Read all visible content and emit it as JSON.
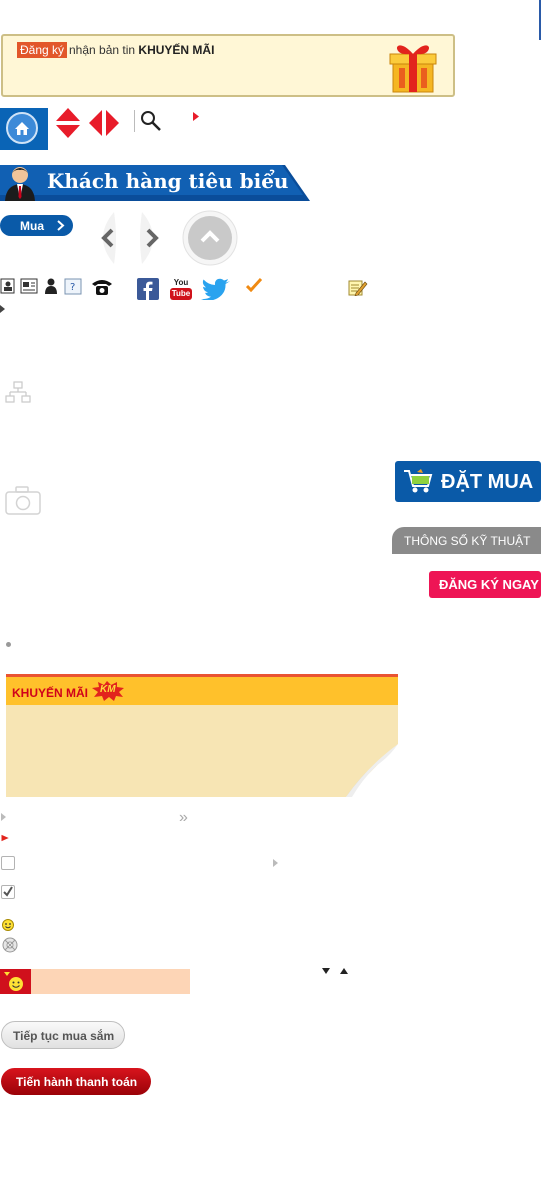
{
  "newsletter": {
    "register_label": "Đăng ký",
    "text_prefix": "nhận bản tin",
    "text_bold": "KHUYẾN MÃI",
    "gift_icon": "gift-box-icon"
  },
  "nav": {
    "home_icon": "home-icon",
    "search_icon": "search-icon"
  },
  "customers": {
    "title": "Khách hàng tiêu biểu"
  },
  "buy": {
    "label": "Mua"
  },
  "social": {
    "icons": [
      "contacts-icon",
      "news-icon",
      "person-icon",
      "help-icon",
      "phone-icon",
      "facebook-icon",
      "youtube-icon",
      "twitter-icon",
      "check-icon",
      "edit-icon"
    ],
    "youtube_text": [
      "You",
      "Tube"
    ]
  },
  "actions": {
    "order_label": "ĐẶT MUA",
    "spec_label": "THÔNG SỐ KỸ THUẬT",
    "register_label": "ĐĂNG KÝ NGAY"
  },
  "promo": {
    "title": "KHUYẾN MÃI",
    "badge": "KM"
  },
  "misc": {
    "double_arrow": "»"
  },
  "cart": {
    "continue_label": "Tiếp tục mua sắm",
    "checkout_label": "Tiến hành thanh toán"
  },
  "colors": {
    "primary_blue": "#0a5aa8",
    "accent_red": "#ee1555",
    "promo_yellow": "#ffc12b",
    "promo_bg": "#f7e5b4"
  }
}
